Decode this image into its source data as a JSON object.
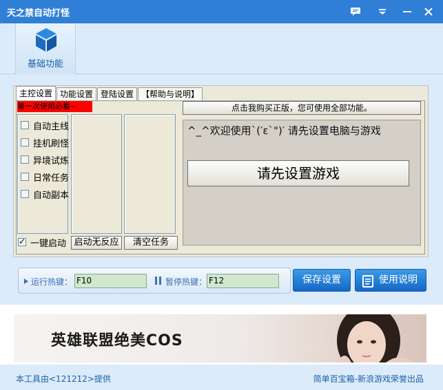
{
  "window": {
    "title": "天之禁自动打怪"
  },
  "toolbar": {
    "basic_label": "基础功能"
  },
  "tabs": [
    "主控设置",
    "功能设置",
    "登陆设置",
    "【帮助与说明】"
  ],
  "main": {
    "first_use_label": "第一次使用必看~",
    "buy_button": "点击我购买正版，您可使用全部功能。",
    "checkbox_items": [
      {
        "label": "自动主线",
        "checked": false
      },
      {
        "label": "挂机刷怪",
        "checked": false
      },
      {
        "label": "异境试炼",
        "checked": false
      },
      {
        "label": "日常任务",
        "checked": false
      },
      {
        "label": "自动副本",
        "checked": false
      }
    ],
    "one_key_start": {
      "label": "一键启动",
      "checked": true
    },
    "no_response_button": "启动无反应",
    "clear_tasks_button": "清空任务",
    "welcome_text": "^_^欢迎使用`(′ε`\")′ 请先设置电脑与游戏",
    "set_game_button": "请先设置游戏"
  },
  "hotkeys": {
    "run_label": "运行热键：",
    "run_value": "F10",
    "pause_label": "暂停热键：",
    "pause_value": "F12"
  },
  "buttons": {
    "save": "保存设置",
    "manual": "使用说明"
  },
  "banner": {
    "text": "英雄联盟绝美COS"
  },
  "footer": {
    "left": "本工具由<121212>提供",
    "right": "简单百宝箱-新浪游戏荣誉出品"
  },
  "colors": {
    "titlebar": "#2f7fd6",
    "accent": "#1b5fa8",
    "red_label": "#ff0000",
    "hotkey_field": "#cfe8cf"
  }
}
